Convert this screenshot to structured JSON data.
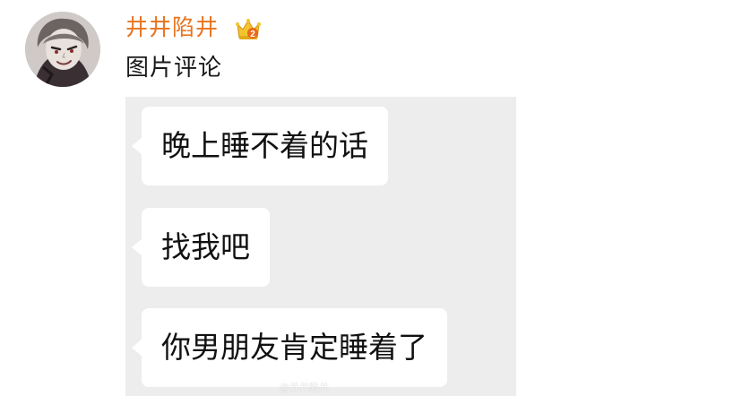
{
  "comment": {
    "username": "井井陷井",
    "text": "图片评论",
    "badge_icon": "crown-icon",
    "username_color": "#e8741f"
  },
  "image": {
    "background_color": "#ededed",
    "bubbles": [
      {
        "text": "晚上睡不着的话"
      },
      {
        "text": "找我吧"
      },
      {
        "text": "你男朋友肯定睡着了"
      }
    ],
    "watermark": "@井井陷井"
  }
}
